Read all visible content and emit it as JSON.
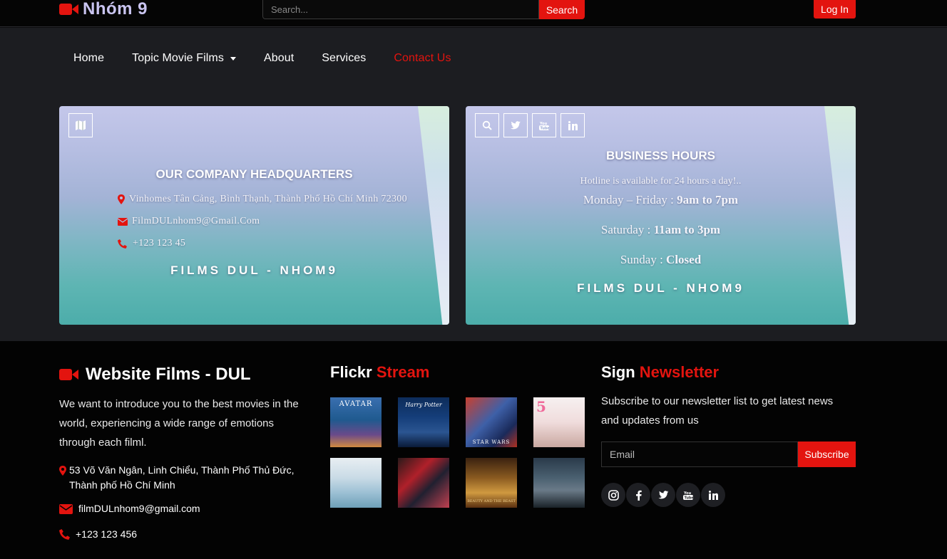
{
  "header": {
    "logo_text": "Nhóm 9",
    "search_placeholder": "Search...",
    "search_button": "Search",
    "login_button": "Log In"
  },
  "nav": {
    "items": [
      {
        "label": "Home"
      },
      {
        "label": "Topic Movie Films",
        "has_dropdown": true
      },
      {
        "label": "About"
      },
      {
        "label": "Services"
      },
      {
        "label": "Contact Us",
        "active": true
      }
    ]
  },
  "headquarters": {
    "title": "OUR COMPANY HEADQUARTERS",
    "address": "Vinhomes Tân Cảng, Bình Thạnh, Thành Phố Hồ Chí Minh 72300",
    "email": "FilmDULnhom9@Gmail.Com",
    "phone": "+123 123 45",
    "brand": "FILMS DUL - NHOM9"
  },
  "business_hours": {
    "title": "BUSINESS HOURS",
    "hotline": "Hotline is available for 24 hours a day!..",
    "weekday_label": "Monday – Friday : ",
    "weekday_hours": "9am to 7pm",
    "saturday_label": "Saturday : ",
    "saturday_hours": "11am to 3pm",
    "sunday_label": "Sunday : ",
    "sunday_hours": "Closed",
    "brand": "FILMS DUL - NHOM9",
    "icons": [
      "search-icon",
      "twitter-icon",
      "youtube-icon",
      "linkedin-icon"
    ]
  },
  "footer": {
    "about": {
      "title": "Website Films - DUL",
      "description": "We want to introduce you to the best movies in the world, experiencing a wide range of emotions through each filml.",
      "address": "53 Võ Văn Ngân, Linh Chiểu, Thành Phố Thủ Đức, Thành phố Hồ Chí Minh",
      "email": "filmDULnhom9@gmail.com",
      "phone": "+123 123 456"
    },
    "flickr": {
      "title_white": "Flickr",
      "title_red": "Stream",
      "thumbs": [
        {
          "name": "avatar-poster",
          "text": "AVATAR"
        },
        {
          "name": "harry-potter-poster",
          "text": "Harry Potter"
        },
        {
          "name": "star-wars-poster",
          "text": "STAR WARS"
        },
        {
          "name": "romance-poster",
          "text": "5"
        },
        {
          "name": "japanese-film-poster",
          "text": ""
        },
        {
          "name": "anime-poster",
          "text": ""
        },
        {
          "name": "beauty-beast-poster",
          "text": "BEAUTY AND THE BEAST"
        },
        {
          "name": "drama-poster",
          "text": ""
        }
      ]
    },
    "newsletter": {
      "title_white": "Sign",
      "title_red": "Newsletter",
      "description": "Subscribe to our newsletter list to get latest news and updates from us",
      "email_placeholder": "Email",
      "subscribe_button": "Subscribe",
      "socials": [
        "instagram-icon",
        "facebook-icon",
        "twitter-icon",
        "youtube-icon",
        "linkedin-icon"
      ]
    }
  },
  "colors": {
    "accent": "#e3140f",
    "nav_bg": "#1c1d21",
    "footer_bg": "#030303"
  }
}
